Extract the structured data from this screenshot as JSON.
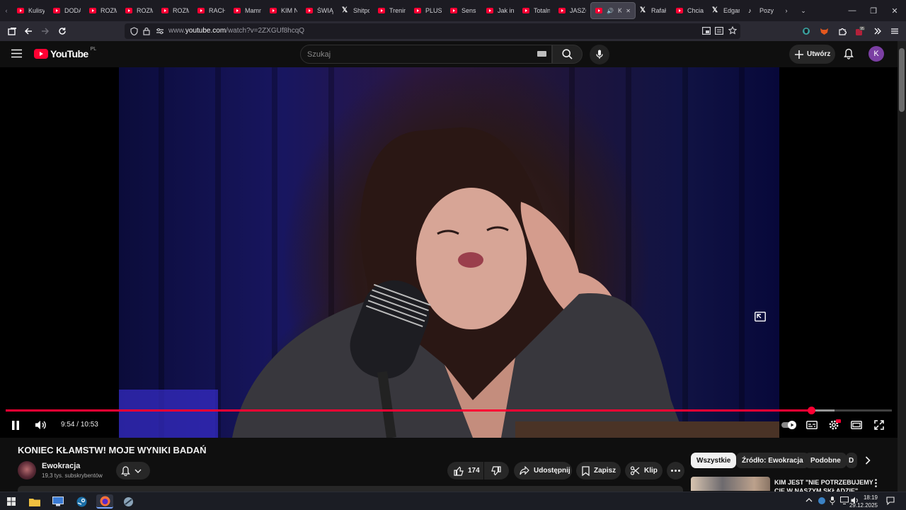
{
  "browser": {
    "tabs": [
      {
        "label": "Kulisy",
        "icon": "youtube-icon"
      },
      {
        "label": "DODA",
        "icon": "youtube-icon"
      },
      {
        "label": "ROZM",
        "icon": "youtube-icon"
      },
      {
        "label": "ROZM",
        "icon": "youtube-icon"
      },
      {
        "label": "ROZM",
        "icon": "youtube-icon"
      },
      {
        "label": "RACH",
        "icon": "youtube-icon"
      },
      {
        "label": "Mamm",
        "icon": "youtube-icon"
      },
      {
        "label": "KIM N",
        "icon": "youtube-icon"
      },
      {
        "label": "ŚWIĄT",
        "icon": "youtube-icon"
      },
      {
        "label": "Shitpo",
        "icon": "x-icon"
      },
      {
        "label": "Trenin",
        "icon": "youtube-icon"
      },
      {
        "label": "PLUSI",
        "icon": "youtube-icon"
      },
      {
        "label": "Sens p",
        "icon": "youtube-icon"
      },
      {
        "label": "Jak in",
        "icon": "youtube-icon"
      },
      {
        "label": "Totaln",
        "icon": "youtube-icon"
      },
      {
        "label": "JASZC",
        "icon": "youtube-icon"
      },
      {
        "label": "KO",
        "icon": "youtube-icon",
        "active": true
      },
      {
        "label": "Rafał",
        "icon": "x-icon"
      },
      {
        "label": "Chcia",
        "icon": "youtube-icon"
      },
      {
        "label": "Edgar",
        "icon": "x-icon"
      },
      {
        "label": "Pozy",
        "icon": "tiktok-icon"
      }
    ],
    "url_prefix": "www.",
    "url_domain": "youtube.com",
    "url_path": "/watch?v=2ZXGUf8hcqQ"
  },
  "youtube": {
    "logo_text": "YouTube",
    "region": "PL",
    "search_placeholder": "Szukaj",
    "create_label": "Utwórz",
    "avatar_letter": "K"
  },
  "player": {
    "current_time": "9:54",
    "duration": "10:53",
    "played_fraction": 0.909,
    "buffered_fraction": 0.935
  },
  "video": {
    "title": "KONIEC KŁAMSTW! MOJE WYNIKI BADAŃ",
    "channel": "Ewokracja",
    "subscribers": "19,3 tys. subskrybentów",
    "likes": "174",
    "share_label": "Udostępnij",
    "save_label": "Zapisz",
    "clip_label": "Klip"
  },
  "recommendations": {
    "chips": [
      "Wszystkie",
      "Źródło: Ewokracja",
      "Podobne",
      "D"
    ],
    "first_title": "KIM JEST \"NIE POTRZEBUJEMY CIĘ W NASZYM SKŁADZIE\""
  },
  "taskbar": {
    "time": "18:19",
    "date": "29.12.2025"
  },
  "colors": {
    "accent": "#ff0033",
    "background": "#0f0f0f",
    "surface": "#272727"
  }
}
